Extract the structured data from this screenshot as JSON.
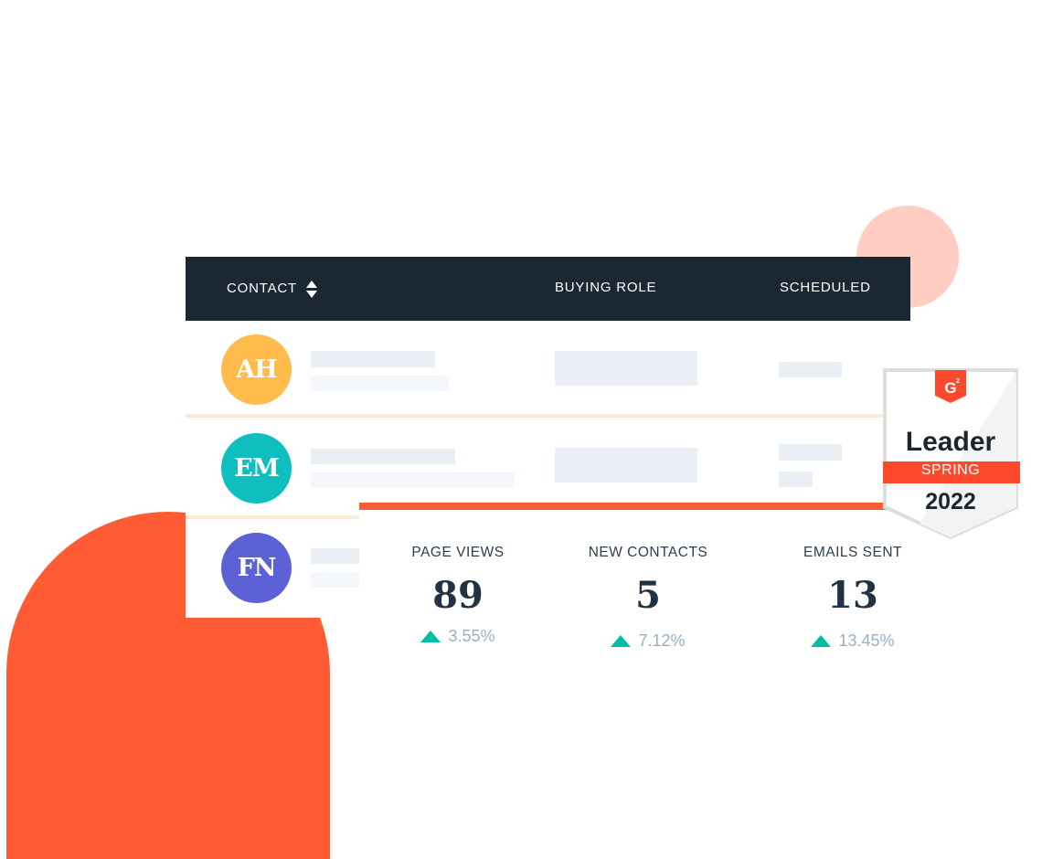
{
  "table": {
    "columns": [
      {
        "label": "CONTACT",
        "sortable": true,
        "icon": "sort-icon"
      },
      {
        "label": "BUYING ROLE"
      },
      {
        "label": "SCHEDULED"
      }
    ],
    "rows": [
      {
        "initials": "AH",
        "avatar_color": "#ffbc4c"
      },
      {
        "initials": "EM",
        "avatar_color": "#0fbfbf"
      },
      {
        "initials": "FN",
        "avatar_color": "#5c62d6"
      }
    ]
  },
  "stats": [
    {
      "label": "PAGE VIEWS",
      "value": "89",
      "change": "3.55%",
      "direction": "up"
    },
    {
      "label": "NEW CONTACTS",
      "value": "5",
      "change": "7.12%",
      "direction": "up"
    },
    {
      "label": "EMAILS SENT",
      "value": "13",
      "change": "13.45%",
      "direction": "up"
    }
  ],
  "badge": {
    "logo": "G2",
    "title": "Leader",
    "season": "SPRING",
    "year": "2022"
  },
  "colors": {
    "accent": "#ff5c35",
    "header_bg": "#1b2733",
    "positive": "#00bda5",
    "pink": "#ffcdc2"
  }
}
